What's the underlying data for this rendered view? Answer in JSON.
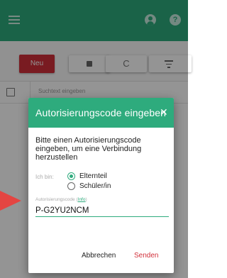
{
  "colors": {
    "brand": "#2eab7d",
    "accent_red": "#d1303a",
    "arrow": "#e44542"
  },
  "appbar": {
    "icons": [
      "menu-icon",
      "account-icon",
      "help-icon"
    ],
    "help_glyph": "?"
  },
  "toolbar": {
    "new_label": "Neu",
    "icons": [
      "square-icon",
      "refresh-icon",
      "filter-icon"
    ],
    "refresh_glyph": "C"
  },
  "list": {
    "search_placeholder": "Suchtext eingeben"
  },
  "dialog": {
    "title": "Autorisierungscode eingeben",
    "close_glyph": "✕",
    "message": "Bitte einen Autorisierungscode eingeben, um eine Verbindung herzustellen",
    "role_label": "Ich bin:",
    "options": [
      {
        "label": "Elternteil",
        "selected": true
      },
      {
        "label": "Schüler/in",
        "selected": false
      }
    ],
    "code_label": "Autorisierungscode",
    "info_link": "Info",
    "code_value": "P-G2YU2NCM",
    "cancel_label": "Abbrechen",
    "send_label": "Senden"
  }
}
